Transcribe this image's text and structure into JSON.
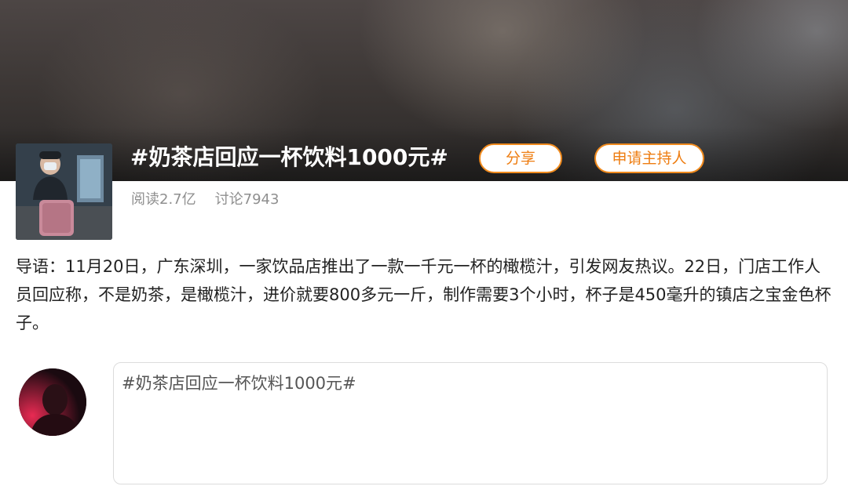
{
  "topic": {
    "title": "#奶茶店回应一杯饮料1000元#",
    "share_label": "分享",
    "host_label": "申请主持人",
    "reads": "阅读2.7亿",
    "discussions": "讨论7943"
  },
  "intro": {
    "text": "导语：11月20日，广东深圳，一家饮品店推出了一款一千元一杯的橄榄汁，引发网友热议。22日，门店工作人员回应称，不是奶茶，是橄榄汁，进价就要800多元一斤，制作需要3个小时，杯子是450毫升的镇店之宝金色杯子。"
  },
  "composer": {
    "placeholder": "#奶茶店回应一杯饮料1000元#"
  },
  "colors": {
    "accent": "#f08a1d",
    "stats_text": "#8f8f8f",
    "body_text": "#222222"
  }
}
